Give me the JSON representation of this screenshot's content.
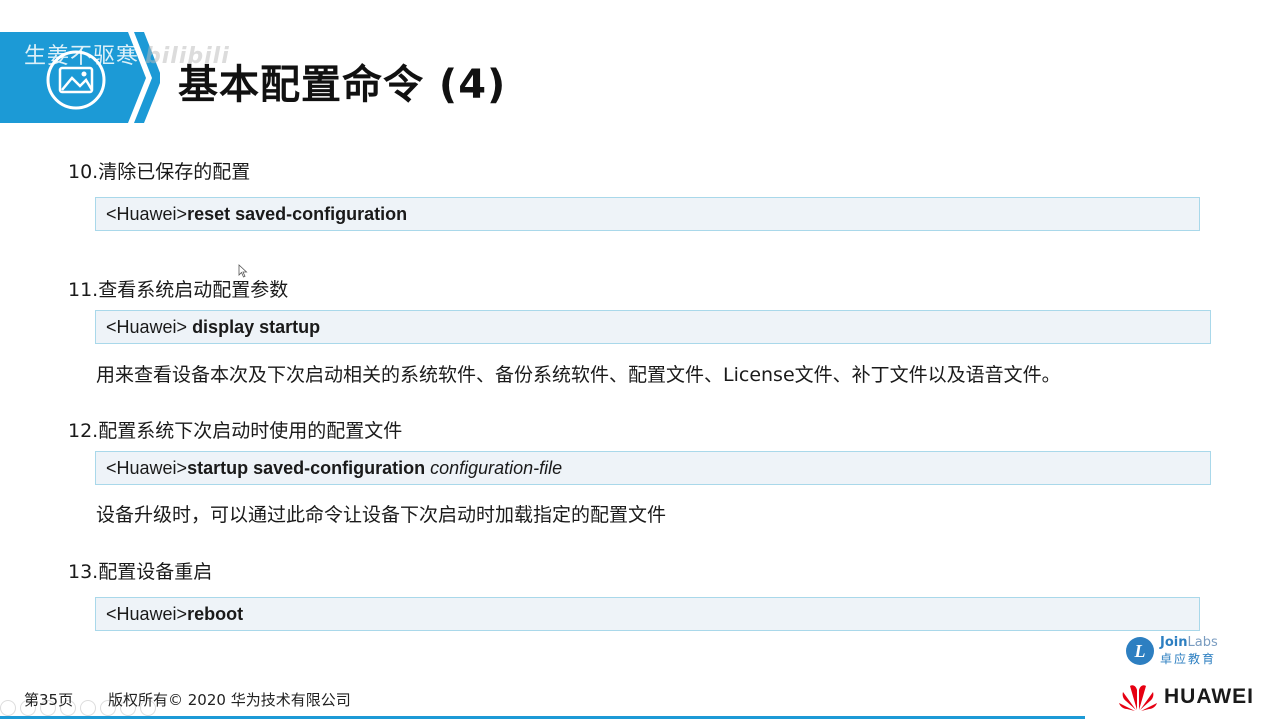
{
  "watermark": {
    "text": "生姜不驱寒",
    "bilibili": "bilibili"
  },
  "slide": {
    "title": "基本配置命令 (4)",
    "sections": [
      {
        "heading": "10.清除已保存的配置",
        "command": {
          "prompt": "<Huawei>",
          "keyword": "reset saved-configuration",
          "argument": ""
        },
        "description": ""
      },
      {
        "heading": "11.查看系统启动配置参数",
        "command": {
          "prompt": "<Huawei> ",
          "keyword": "display startup",
          "argument": ""
        },
        "description": "用来查看设备本次及下次启动相关的系统软件、备份系统软件、配置文件、License文件、补丁文件以及语音文件。"
      },
      {
        "heading": "12.配置系统下次启动时使用的配置文件",
        "command": {
          "prompt": "<Huawei>",
          "keyword": "startup saved-configuration",
          "argument": " configuration-file"
        },
        "description": "设备升级时，可以通过此命令让设备下次启动时加载指定的配置文件"
      },
      {
        "heading": "13.配置设备重启",
        "command": {
          "prompt": "<Huawei>",
          "keyword": "reboot",
          "argument": ""
        },
        "description": ""
      }
    ]
  },
  "footer": {
    "page": "第35页",
    "copyright": "版权所有© 2020 华为技术有限公司",
    "brand": "HUAWEI",
    "joinlabs_name": "Join",
    "joinlabs_suffix": "Labs",
    "joinlabs_cn": "卓应教育",
    "joinlabs_letter": "L"
  },
  "colors": {
    "accent": "#1c9ad6",
    "cmd_bg": "#eef3f8",
    "cmd_border": "#a9d8ea",
    "huawei_red": "#e60012"
  }
}
